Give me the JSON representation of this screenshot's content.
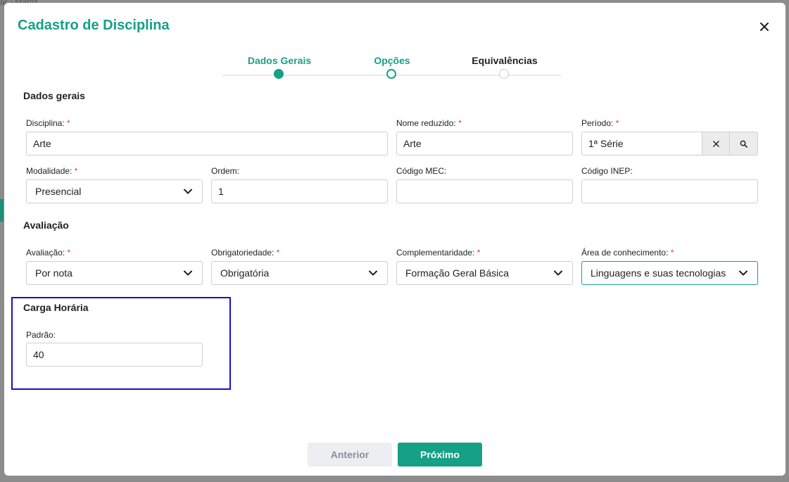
{
  "backdrop": {
    "breadcrumb_text": "ar  ›  Matriz"
  },
  "modal": {
    "title": "Cadastro de Disciplina"
  },
  "stepper": {
    "steps": [
      {
        "label": "Dados Gerais",
        "state": "completed"
      },
      {
        "label": "Opções",
        "state": "current"
      },
      {
        "label": "Equivalências",
        "state": "pending"
      }
    ]
  },
  "sections": {
    "dados_gerais": "Dados gerais",
    "avaliacao": "Avaliação",
    "carga_horaria": "Carga Horária"
  },
  "fields": {
    "disciplina": {
      "label": "Disciplina:",
      "value": "Arte",
      "required": "*"
    },
    "nome_reduzido": {
      "label": "Nome reduzido:",
      "value": "Arte",
      "required": "*"
    },
    "periodo": {
      "label": "Período:",
      "value": "1ª Série",
      "required": "*"
    },
    "modalidade": {
      "label": "Modalidade:",
      "value": "Presencial",
      "required": "*"
    },
    "ordem": {
      "label": "Ordem:",
      "value": "1"
    },
    "codigo_mec": {
      "label": "Código MEC:",
      "value": ""
    },
    "codigo_inep": {
      "label": "Código INEP:",
      "value": ""
    },
    "avaliacao": {
      "label": "Avaliação:",
      "value": "Por nota",
      "required": "*"
    },
    "obrigatoriedade": {
      "label": "Obrigatoriedade:",
      "value": "Obrigatória",
      "required": "*"
    },
    "complementaridade": {
      "label": "Complementaridade:",
      "value": "Formação Geral Básica",
      "required": "*"
    },
    "area_conhecimento": {
      "label": "Área de conhecimento:",
      "value": "Linguagens e suas tecnologias",
      "required": "*"
    },
    "padrao": {
      "label": "Padrão:",
      "value": "40"
    }
  },
  "buttons": {
    "anterior": "Anterior",
    "proximo": "Próximo"
  },
  "colors": {
    "accent": "#16a085",
    "required": "#e53935",
    "highlight": "#1212c8"
  }
}
